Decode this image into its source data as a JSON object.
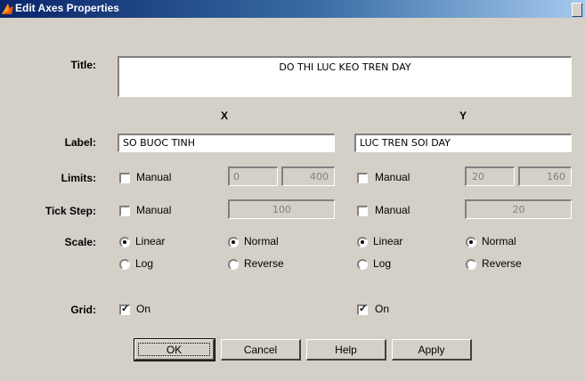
{
  "window": {
    "title": "Edit Axes Properties"
  },
  "labels": {
    "title": "Title:",
    "label": "Label:",
    "limits": "Limits:",
    "tick_step": "Tick Step:",
    "scale": "Scale:",
    "grid": "Grid:"
  },
  "title_value": "DO THI LUC KEO TREN DAY",
  "x_axis": {
    "header": "X",
    "label_value": "SO BUOC TINH",
    "limits_manual_label": "Manual",
    "limits_manual_checked": false,
    "limit_min": "0",
    "limit_max": "400",
    "tick_manual_label": "Manual",
    "tick_manual_checked": false,
    "tick_step": "100",
    "scale_linear": "Linear",
    "scale_log": "Log",
    "scale_normal": "Normal",
    "scale_reverse": "Reverse",
    "scale_selected": "Linear",
    "direction_selected": "Normal",
    "grid_label": "On",
    "grid_checked": true
  },
  "y_axis": {
    "header": "Y",
    "label_value": "LUC TREN SOI DAY",
    "limits_manual_label": "Manual",
    "limits_manual_checked": false,
    "limit_min": "20",
    "limit_max": "160",
    "tick_manual_label": "Manual",
    "tick_manual_checked": false,
    "tick_step": "20",
    "scale_linear": "Linear",
    "scale_log": "Log",
    "scale_normal": "Normal",
    "scale_reverse": "Reverse",
    "scale_selected": "Linear",
    "direction_selected": "Normal",
    "grid_label": "On",
    "grid_checked": true
  },
  "buttons": {
    "ok": "OK",
    "cancel": "Cancel",
    "help": "Help",
    "apply": "Apply"
  },
  "icons": {
    "app": "matlab-icon"
  }
}
